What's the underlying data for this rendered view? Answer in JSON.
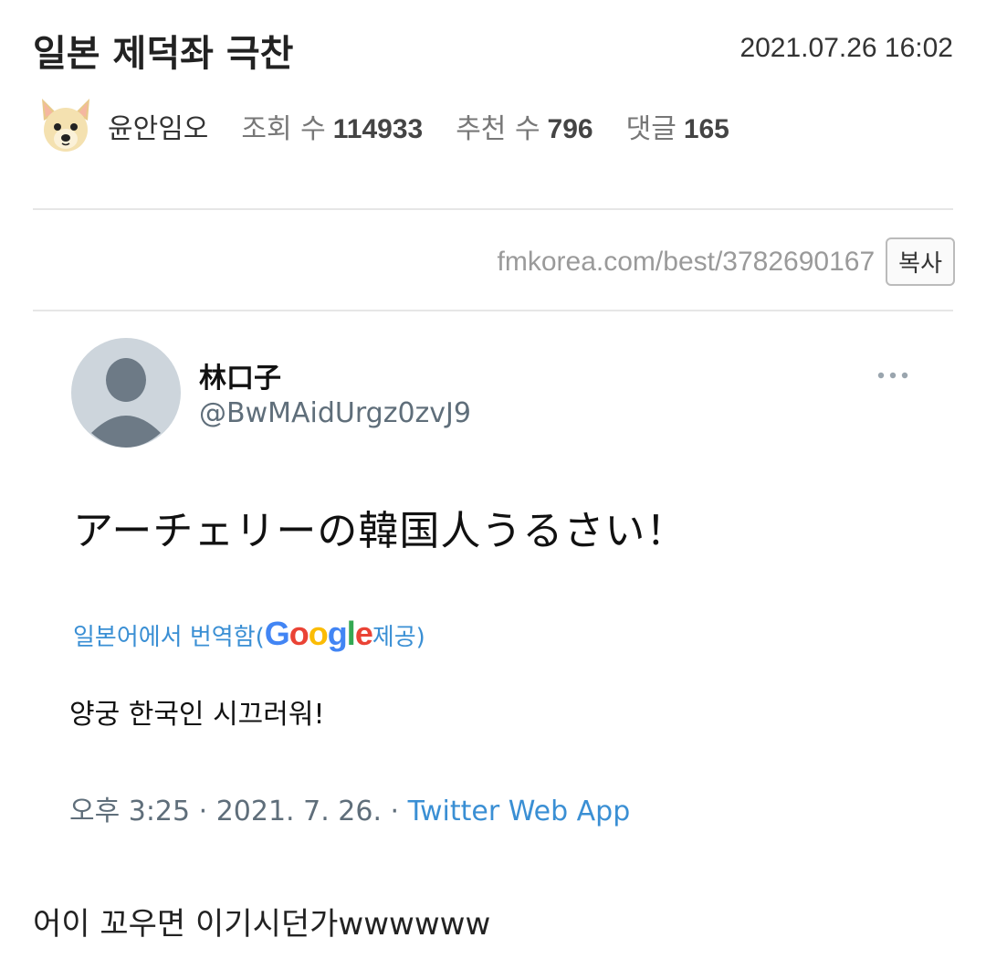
{
  "post": {
    "title": "일본 제덕좌 극찬",
    "date": "2021.07.26 16:02",
    "author": "윤안임오",
    "views_label": "조회 수",
    "views": "114933",
    "recommends_label": "추천 수",
    "recommends": "796",
    "comments_label": "댓글",
    "comments": "165",
    "url": "fmkorea.com/best/3782690167",
    "copy_label": "복사"
  },
  "tweet": {
    "name": "林口子",
    "handle": "@BwMAidUrgz0zvJ9",
    "text": "アーチェリーの韓国人うるさい！",
    "translated_from": "일본어에서 번역함(",
    "google_letters": [
      "G",
      "o",
      "o",
      "g",
      "l",
      "e"
    ],
    "google_colors": [
      "#4285F4",
      "#EA4335",
      "#FBBC05",
      "#4285F4",
      "#34A853",
      "#EA4335"
    ],
    "provided_by": " 제공)",
    "translation": "양궁 한국인 시끄러워!",
    "timestamp": "오후 3:25 · 2021. 7. 26. · ",
    "source_app": "Twitter Web App"
  },
  "body_text": "어이 꼬우면 이기시던가wwwwww",
  "colors": {
    "link_blue": "#3a8fd4",
    "muted_text": "#5f6e7a"
  }
}
